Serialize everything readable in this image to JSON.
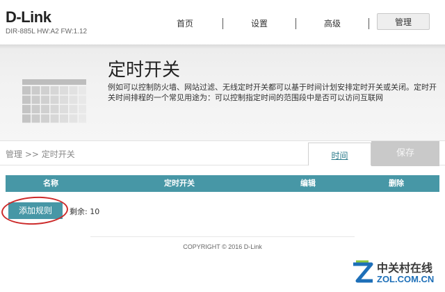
{
  "header": {
    "brand": "D-Link",
    "model": "DIR-885L  HW:A2  FW:1.12"
  },
  "nav": {
    "items": [
      {
        "label": "首页",
        "active": false
      },
      {
        "label": "设置",
        "active": false
      },
      {
        "label": "高级",
        "active": false
      },
      {
        "label": "管理",
        "active": true
      }
    ]
  },
  "banner": {
    "title": "定时开关",
    "description": "例如可以控制防火墙、网站过滤、无线定时开关都可以基于时间计划安排定时开关或关闭。定时开关时间排程的一个常见用途为：可以控制指定时间的范围段中是否可以访问互联网",
    "icon": "calendar-icon"
  },
  "breadcrumb": {
    "text": "管理 >> 定时开关"
  },
  "actions": {
    "time_label": "时间",
    "save_label": "保存"
  },
  "table": {
    "columns": [
      "名称",
      "定时开关",
      "编辑",
      "删除"
    ],
    "rows": []
  },
  "rules": {
    "add_label": "添加规则",
    "remaining": "剩余: 10"
  },
  "footer": {
    "copyright": "COPYRIGHT © 2016 D-Link"
  },
  "watermark": {
    "cn": "中关村在线",
    "en": "ZOL.COM.CN"
  },
  "colors": {
    "accent": "#4797a6",
    "annotation": "#cc2a2a",
    "save_disabled": "#c9c9c9"
  }
}
